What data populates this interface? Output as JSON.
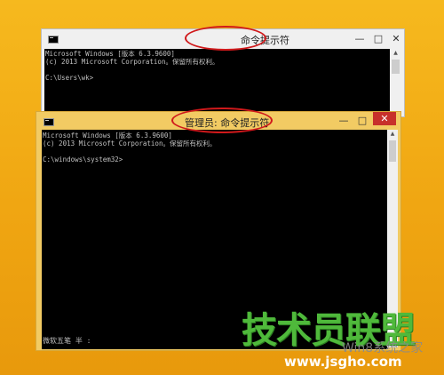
{
  "desktop": {
    "background_color": "#f0a612"
  },
  "window_back": {
    "title": "命令提示符",
    "buttons": {
      "minimize": "—",
      "maximize": "□",
      "close": "✕"
    },
    "console_lines": [
      "Microsoft Windows [版本 6.3.9600]",
      "(c) 2013 Microsoft Corporation。保留所有权利。",
      "",
      "C:\\Users\\wk>"
    ]
  },
  "window_front": {
    "title": "管理员: 命令提示符",
    "buttons": {
      "minimize": "—",
      "maximize": "□",
      "close": "✕"
    },
    "console_lines": [
      "Microsoft Windows [版本 6.3.9600]",
      "(c) 2013 Microsoft Corporation。保留所有权利。",
      "",
      "C:\\windows\\system32>"
    ],
    "ime_status": "微软五笔 半 :"
  },
  "annotation": {
    "color": "#d0191b"
  },
  "watermark": {
    "logo_text": "技术员联盟",
    "site": "www.jsgho.com",
    "slogan": "Win8系统之家",
    "color": "#4fb93b"
  }
}
